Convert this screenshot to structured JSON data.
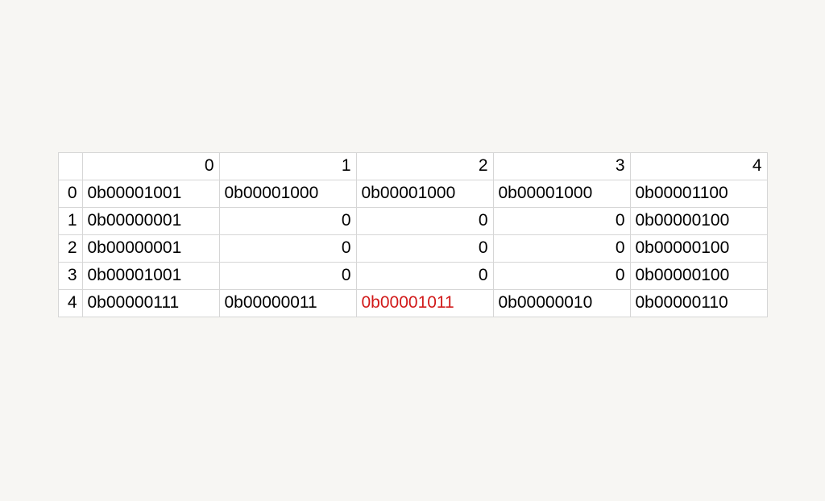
{
  "columns": [
    "0",
    "1",
    "2",
    "3",
    "4"
  ],
  "rows": [
    {
      "index": "0",
      "cells": [
        {
          "v": "0b00001001",
          "t": "text"
        },
        {
          "v": "0b00001000",
          "t": "text"
        },
        {
          "v": "0b00001000",
          "t": "text"
        },
        {
          "v": "0b00001000",
          "t": "text"
        },
        {
          "v": "0b00001100",
          "t": "text"
        }
      ]
    },
    {
      "index": "1",
      "cells": [
        {
          "v": "0b00000001",
          "t": "text"
        },
        {
          "v": "0",
          "t": "num"
        },
        {
          "v": "0",
          "t": "num"
        },
        {
          "v": "0",
          "t": "num"
        },
        {
          "v": "0b00000100",
          "t": "text"
        }
      ]
    },
    {
      "index": "2",
      "cells": [
        {
          "v": "0b00000001",
          "t": "text"
        },
        {
          "v": "0",
          "t": "num"
        },
        {
          "v": "0",
          "t": "num"
        },
        {
          "v": "0",
          "t": "num"
        },
        {
          "v": "0b00000100",
          "t": "text"
        }
      ]
    },
    {
      "index": "3",
      "cells": [
        {
          "v": "0b00001001",
          "t": "text"
        },
        {
          "v": "0",
          "t": "num"
        },
        {
          "v": "0",
          "t": "num"
        },
        {
          "v": "0",
          "t": "num"
        },
        {
          "v": "0b00000100",
          "t": "text"
        }
      ]
    },
    {
      "index": "4",
      "cells": [
        {
          "v": "0b00000111",
          "t": "text"
        },
        {
          "v": "0b00000011",
          "t": "text"
        },
        {
          "v": "0b00001011",
          "t": "text",
          "highlight": true
        },
        {
          "v": "0b00000010",
          "t": "text"
        },
        {
          "v": "0b00000110",
          "t": "text"
        }
      ]
    }
  ]
}
